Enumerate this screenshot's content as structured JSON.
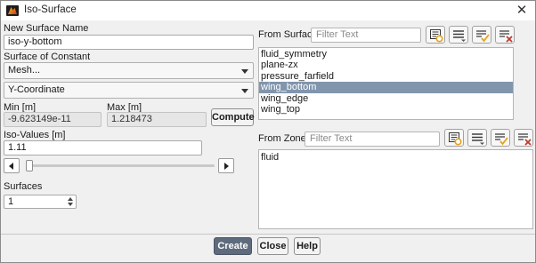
{
  "window": {
    "title": "Iso-Surface",
    "close_glyph": "✕"
  },
  "left": {
    "new_surface_name_label": "New Surface Name",
    "new_surface_name_value": "iso-y-bottom",
    "surface_of_constant_label": "Surface of Constant",
    "surface_of_constant_value": "Mesh...",
    "coordinate_value": "Y-Coordinate",
    "min_label": "Min [m]",
    "min_value": "-9.623149e-11",
    "max_label": "Max [m]",
    "max_value": "1.218473",
    "compute_label": "Compute",
    "iso_values_label": "Iso-Values [m]",
    "iso_values_value": "1.11",
    "slider_fraction": 0.0,
    "surfaces_label": "Surfaces",
    "surfaces_value": "1"
  },
  "from_surface": {
    "label": "From Surface",
    "filter_placeholder": "Filter Text",
    "items": [
      "fluid_symmetry",
      "plane-zx",
      "pressure_farfield",
      "wing_bottom",
      "wing_edge",
      "wing_top"
    ],
    "selected_index": 3
  },
  "from_zones": {
    "label": "From Zones",
    "filter_placeholder": "Filter Text",
    "items": [
      "fluid"
    ]
  },
  "icons": [
    "select-all-icon",
    "list-options-icon",
    "check-all-icon",
    "deselect-all-icon"
  ],
  "footer": {
    "create_label": "Create",
    "close_label": "Close",
    "help_label": "Help"
  },
  "colors": {
    "accent": "#5d6b7d",
    "selection": "#8196ad",
    "check": "#e3a21a",
    "clear": "#c0392b"
  }
}
